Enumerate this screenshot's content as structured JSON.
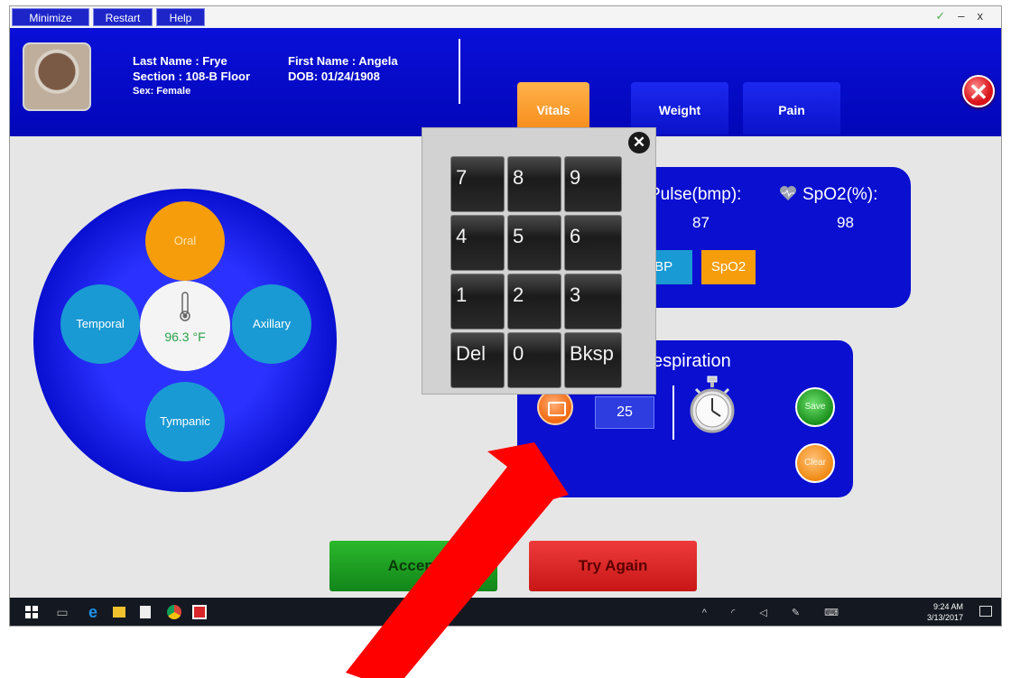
{
  "menu": {
    "minimize": "Minimize",
    "restart": "Restart",
    "help": "Help"
  },
  "window_controls": {
    "check": "✓",
    "minimize": "–",
    "close": "x"
  },
  "patient": {
    "last_name": "Last Name : Frye",
    "section": "Section : 108-B Floor",
    "sex": "Sex: Female",
    "first_name": "First Name : Angela",
    "dob": "DOB: 01/24/1908"
  },
  "tabs": [
    {
      "label": "Vitals"
    },
    {
      "label": "Weight"
    },
    {
      "label": "Pain"
    }
  ],
  "close_symbol": "✕",
  "temperature": {
    "sites": {
      "oral": "Oral",
      "temporal": "Temporal",
      "axillary": "Axillary",
      "tympanic": "Tympanic"
    },
    "value": "96.3 °F"
  },
  "vitals": {
    "pulse_label": "Pulse(bmp):",
    "spo2_label": "SpO2(%):",
    "pulse_value": "87",
    "spo2_value": "98",
    "nibp_button": "IBP",
    "spo2_button": "SpO2"
  },
  "respiration": {
    "label": "espiration",
    "count": "25",
    "save": "Save",
    "clear": "Clear"
  },
  "keypad": {
    "close_symbol": "✕",
    "keys": [
      "7",
      "8",
      "9",
      "4",
      "5",
      "6",
      "1",
      "2",
      "3",
      "Del",
      "0",
      "Bksp"
    ]
  },
  "actions": {
    "accept": "Accept",
    "try_again": "Try Again"
  },
  "taskbar": {
    "time": "9:24 AM",
    "date": "3/13/2017",
    "tray": "^ ◜ ◁ ✎ ⌨"
  },
  "colors": {
    "header_blue": "#0a0fd8",
    "active_tab_orange": "#f69d0b",
    "site_teal": "#1a9ad4",
    "accept_green": "#1aa11f",
    "try_again_red": "#dd2222",
    "arrow_red": "#ff0000"
  }
}
